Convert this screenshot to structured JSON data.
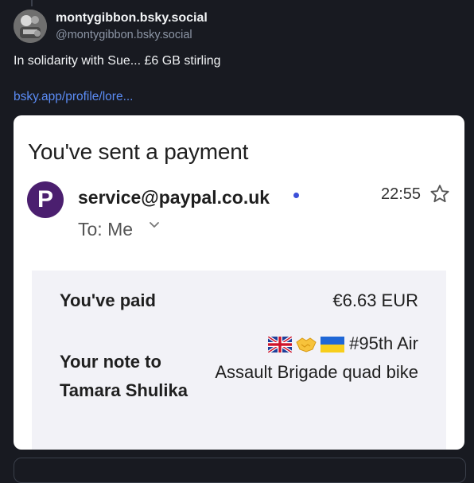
{
  "post": {
    "display_name": "montygibbon.bsky.social",
    "handle": "@montygibbon.bsky.social",
    "text": "In solidarity with Sue... £6 GB stirling",
    "link": "bsky.app/profile/lore..."
  },
  "email": {
    "subject": "You've sent a payment",
    "sender_initial": "P",
    "sender": "service@paypal.co.uk",
    "time": "22:55",
    "recipient": "To: Me",
    "paid_label": "You've paid",
    "paid_value": "€6.63 EUR",
    "note_label": "Your note to Tamara Shulika",
    "note_text": "#95th Air Assault Brigade quad bike",
    "note_emojis": [
      "uk-flag-icon",
      "handshake-icon",
      "ukraine-flag-icon"
    ]
  },
  "colors": {
    "background": "#181a21",
    "link": "#5b8cf5",
    "paypal_logo": "#4b1f6f",
    "unread_dot": "#3b4fd8",
    "details_bg": "#f2f2f7"
  }
}
